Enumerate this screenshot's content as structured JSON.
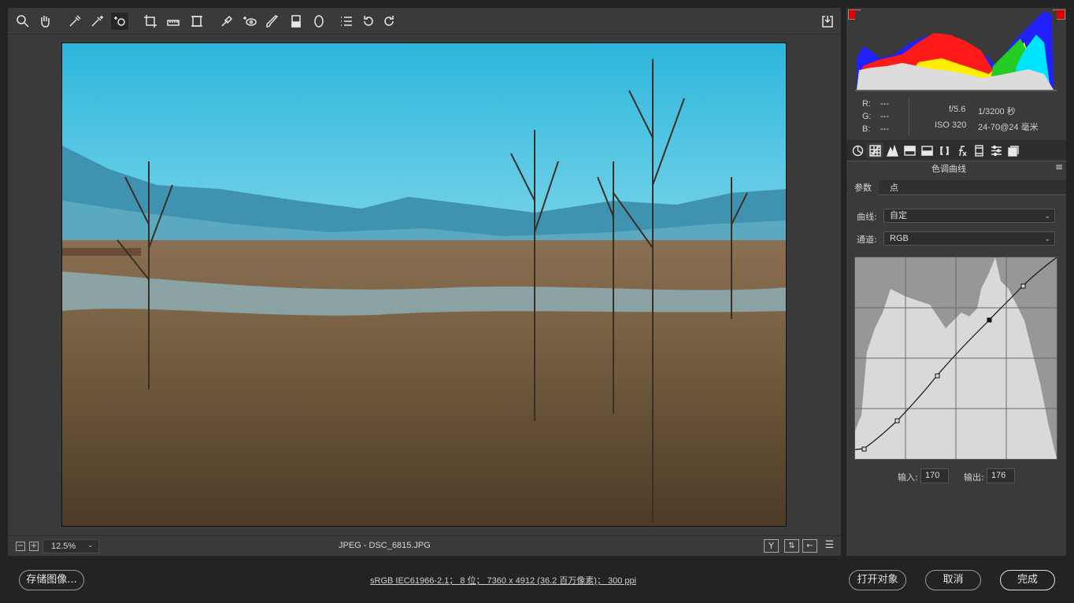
{
  "toolbar": {
    "tools": [
      "zoom-tool",
      "hand-tool",
      "white-balance-tool",
      "color-sampler-tool",
      "targeted-adjustment-tool",
      "crop-tool",
      "straighten-tool",
      "transform-tool",
      "spot-removal-tool",
      "red-eye-tool",
      "adjustment-brush-tool",
      "graduated-filter-tool",
      "radial-filter-tool",
      "preferences-tool",
      "rotate-left-tool",
      "rotate-right-tool"
    ],
    "fullscreen_icon": "fullscreen-icon"
  },
  "canvas": {
    "zoom": "12.5%",
    "filename": "JPEG -  DSC_6815.JPG"
  },
  "histogram": {
    "r_label": "R:",
    "r_value": "---",
    "g_label": "G:",
    "g_value": "---",
    "b_label": "B:",
    "b_value": "---",
    "aperture": "f/5.6",
    "shutter": "1/3200 秒",
    "iso": "ISO 320",
    "lens": "24-70@24 毫米"
  },
  "panel": {
    "title": "色调曲线",
    "subtabs": [
      "参数",
      "点"
    ],
    "curve_label": "曲线:",
    "curve_value": "自定",
    "channel_label": "通道:",
    "channel_value": "RGB",
    "input_label": "输入:",
    "input_value": "170",
    "output_label": "输出:",
    "output_value": "176"
  },
  "footer": {
    "save_label": "存储图像...",
    "workflow_info": "sRGB IEC61966-2.1； 8 位； 7360 x 4912 (36.2 百万像素)； 300 ppi",
    "open_label": "打开对象",
    "cancel_label": "取消",
    "done_label": "完成"
  },
  "colors": {
    "accent_clip": "#ff0000",
    "panel_bg": "#3a3a3a",
    "app_bg": "#232323"
  }
}
